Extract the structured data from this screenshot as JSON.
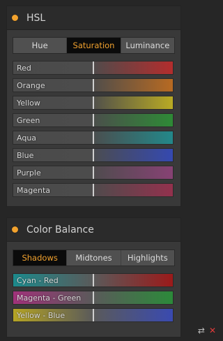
{
  "hsl": {
    "title": "HSL",
    "tabs": [
      "Hue",
      "Saturation",
      "Luminance"
    ],
    "active_tab": "Saturation",
    "sliders": [
      {
        "label": "Red",
        "color": "#b32d2d"
      },
      {
        "label": "Orange",
        "color": "#b76a22"
      },
      {
        "label": "Yellow",
        "color": "#b9aa24"
      },
      {
        "label": "Green",
        "color": "#2e8a36"
      },
      {
        "label": "Aqua",
        "color": "#23888a"
      },
      {
        "label": "Blue",
        "color": "#3549b0"
      },
      {
        "label": "Purple",
        "color": "#874274"
      },
      {
        "label": "Magenta",
        "color": "#93314d"
      }
    ]
  },
  "color_balance": {
    "title": "Color Balance",
    "tabs": [
      "Shadows",
      "Midtones",
      "Highlights"
    ],
    "active_tab": "Shadows",
    "sliders": [
      {
        "label": "Cyan - Red",
        "left_color": "#1c8a8c",
        "right_color": "#9b1a1a"
      },
      {
        "label": "Magenta - Green",
        "left_color": "#a0327a",
        "right_color": "#2c8a3a"
      },
      {
        "label": "Yellow - Blue",
        "left_color": "#b5a424",
        "right_color": "#3a4ab0"
      }
    ]
  },
  "footer": {
    "reset_icon": "reset-icon",
    "close_icon": "close-icon"
  }
}
